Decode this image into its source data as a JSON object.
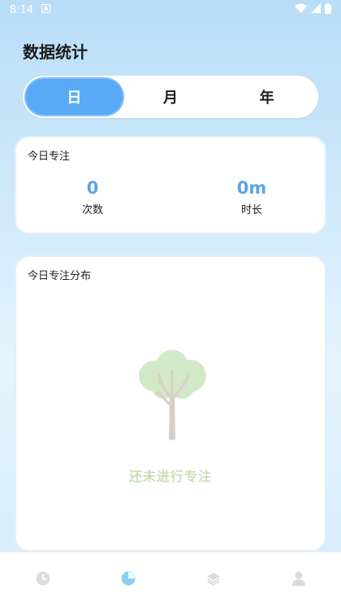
{
  "status_bar": {
    "time": "8:14"
  },
  "page_title": "数据统计",
  "segments": [
    {
      "label": "日",
      "active": true
    },
    {
      "label": "月",
      "active": false
    },
    {
      "label": "年",
      "active": false
    }
  ],
  "today_card": {
    "title": "今日专注",
    "count": {
      "value": "0",
      "label": "次数"
    },
    "duration": {
      "value": "0m",
      "label": "时长"
    }
  },
  "distribution_card": {
    "title": "今日专注分布",
    "empty_text": "还未进行专注"
  },
  "bottom_nav": [
    {
      "icon": "clock-icon",
      "active": false
    },
    {
      "icon": "stats-pie-icon",
      "active": true
    },
    {
      "icon": "layers-icon",
      "active": false
    },
    {
      "icon": "user-icon",
      "active": false
    }
  ],
  "colors": {
    "accent": "#58aaf6",
    "stat_value": "#5aa6e8",
    "empty_text": "#c7e0b6",
    "nav_inactive": "#d9d9d9",
    "nav_active": "#8ccdf0"
  }
}
